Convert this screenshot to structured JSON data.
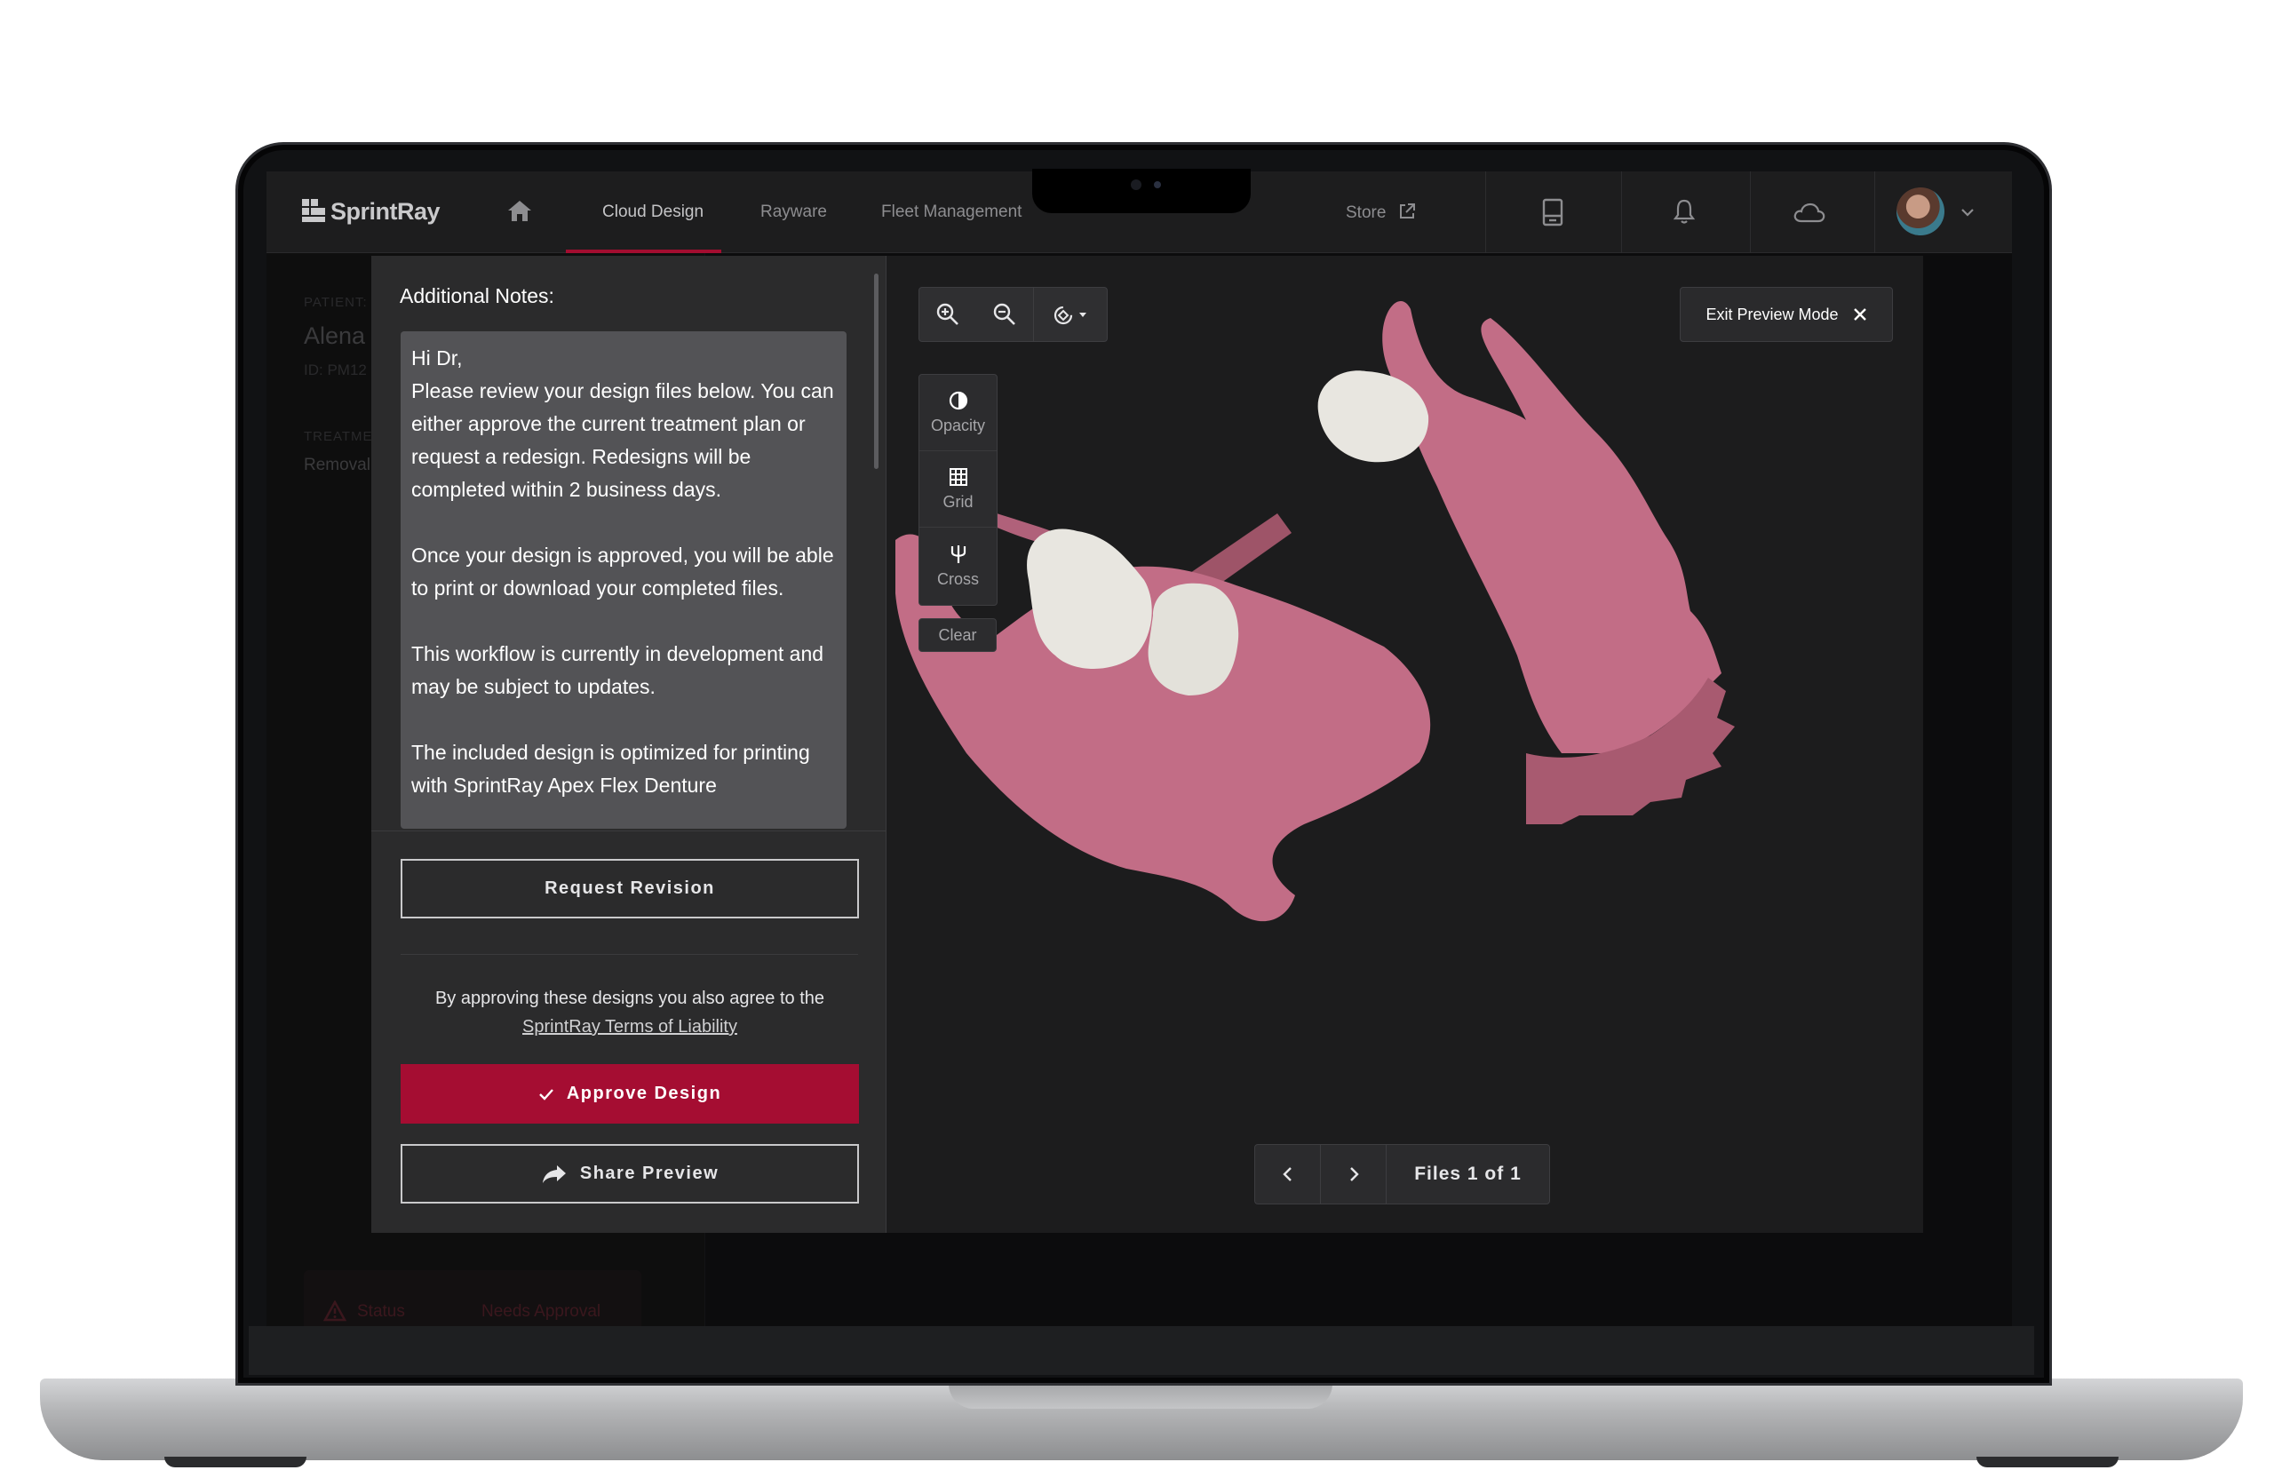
{
  "nav": {
    "logo_text": "SprintRay",
    "items": [
      {
        "label": "Cloud Design",
        "active": true
      },
      {
        "label": "Rayware",
        "active": false
      },
      {
        "label": "Fleet Management",
        "active": false
      }
    ],
    "store_label": "Store",
    "icons": [
      "home-icon",
      "external-link-icon",
      "printer-icon",
      "bell-icon",
      "cloud-icon",
      "avatar",
      "chevron-down-icon"
    ]
  },
  "background": {
    "patient_label": "PATIENT:",
    "patient_name": "Alena",
    "patient_id": "ID: PM12",
    "treatment_label": "TREATME",
    "treatment_value": "Removal",
    "status_label": "Status",
    "status_value": "Needs Approval"
  },
  "notes": {
    "title": "Additional Notes:",
    "body": "Hi Dr,\nPlease review your design files below. You can either approve the current treatment plan or request a redesign. Redesigns will be completed within 2 business days.\n\nOnce your design is approved, you will be able to print or download your completed files.\n\nThis workflow is currently in development and may be subject to updates.\n\nThe included design is optimized for printing with SprintRay Apex Flex Denture"
  },
  "actions": {
    "request_revision": "Request Revision",
    "agree_text": "By approving these designs you also agree to the",
    "terms_link": "SprintRay Terms of Liability",
    "approve": "Approve Design",
    "share": "Share Preview"
  },
  "viewer": {
    "tools": [
      {
        "label": "Opacity",
        "icon": "opacity-icon"
      },
      {
        "label": "Grid",
        "icon": "grid-icon"
      },
      {
        "label": "Cross",
        "icon": "cross-section-icon"
      }
    ],
    "clear_label": "Clear",
    "exit_label": "Exit Preview Mode",
    "files_label": "Files 1 of 1"
  },
  "colors": {
    "accent": "#a50d32",
    "gum": "#c26d86",
    "tooth": "#e8e6e0"
  }
}
